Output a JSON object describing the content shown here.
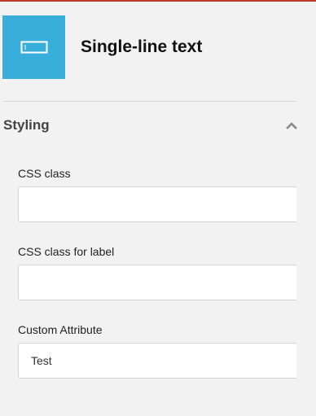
{
  "header": {
    "icon": "single-line-text-icon",
    "title": "Single-line text"
  },
  "styling_section": {
    "title": "Styling",
    "collapse_icon": "chevron-up-icon",
    "expanded": true,
    "fields": [
      {
        "label": "CSS class",
        "value": "",
        "placeholder": ""
      },
      {
        "label": "CSS class for label",
        "value": "",
        "placeholder": ""
      },
      {
        "label": "Custom Attribute",
        "value": "Test",
        "placeholder": ""
      }
    ]
  },
  "colors": {
    "accent_top": "#c0392b",
    "icon_tile": "#3aaedb",
    "background": "#f2f2f2"
  }
}
